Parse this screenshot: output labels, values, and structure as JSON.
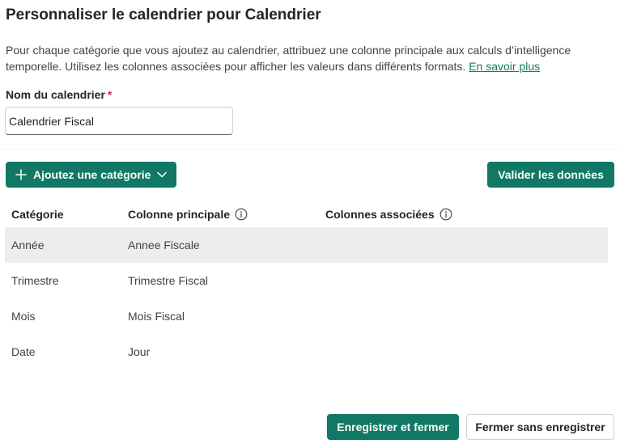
{
  "dialog": {
    "title": "Personnaliser le calendrier pour Calendrier",
    "description": "Pour chaque catégorie que vous ajoutez au calendrier, attribuez une colonne principale aux calculs d’intelligence temporelle. Utilisez les colonnes associées pour afficher les valeurs dans différents formats.",
    "learn_more_link": "En savoir plus"
  },
  "calendar_name": {
    "label": "Nom du calendrier",
    "required_marker": "*",
    "value": "Calendrier Fiscal"
  },
  "toolbar": {
    "add_category_label": "Ajoutez une catégorie",
    "validate_label": "Valider les données",
    "accent_color": "#117865"
  },
  "table": {
    "headers": {
      "category": "Catégorie",
      "main_column": "Colonne principale",
      "associated_columns": "Colonnes associées"
    },
    "rows": [
      {
        "category": "Année",
        "main_column": "Annee Fiscale",
        "selected": true
      },
      {
        "category": "Trimestre",
        "main_column": "Trimestre Fiscal",
        "selected": false
      },
      {
        "category": "Mois",
        "main_column": "Mois Fiscal",
        "selected": false
      },
      {
        "category": "Date",
        "main_column": "Jour",
        "selected": false
      }
    ]
  },
  "footer": {
    "save_label": "Enregistrer et fermer",
    "close_label": "Fermer sans enregistrer"
  }
}
